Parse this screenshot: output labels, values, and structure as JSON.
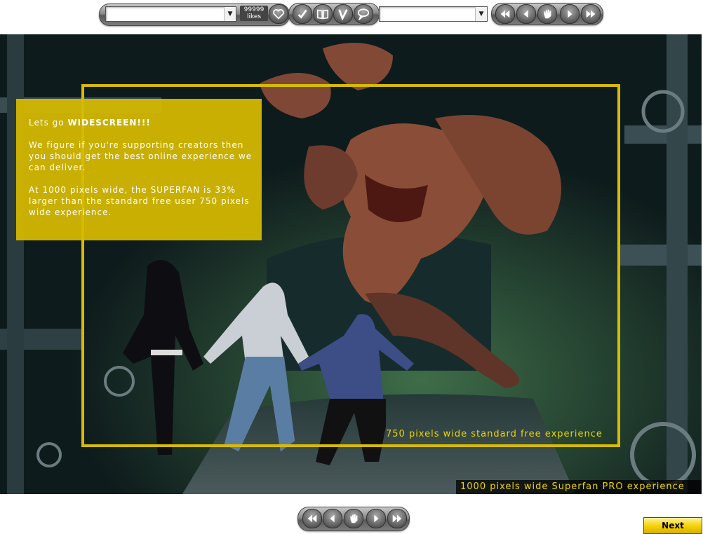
{
  "toolbar": {
    "chapter_select_value": "",
    "likes_count": "99999",
    "likes_label": "likes",
    "page_select_value": ""
  },
  "icons": {
    "like": "heart-icon",
    "mark_read": "checkmark-icon",
    "bookmark": "open-book-icon",
    "vote": "v-icon",
    "comment": "speech-bubble-icon",
    "first": "double-left-arrow-icon",
    "prev": "left-arrow-icon",
    "home": "hand-icon",
    "next": "right-arrow-icon",
    "last": "double-right-arrow-icon"
  },
  "comic": {
    "info": {
      "line1_prefix": "Lets go ",
      "line1_bold": "WIDESCREEN!!!",
      "paragraph2": "We figure if you're supporting creators then you should get the best online experience we can deliver.",
      "paragraph3": "At 1000 pixels wide, the SUPERFAN is 33% larger than the standard free user 750 pixels wide experience."
    },
    "caption_750": "750 pixels wide standard free experience",
    "caption_1000": "1000 pixels wide Superfan PRO experience"
  },
  "footer": {
    "next_label": "Next"
  },
  "colors": {
    "accent_yellow": "#d7bb00",
    "caption_text": "#f0d400"
  }
}
